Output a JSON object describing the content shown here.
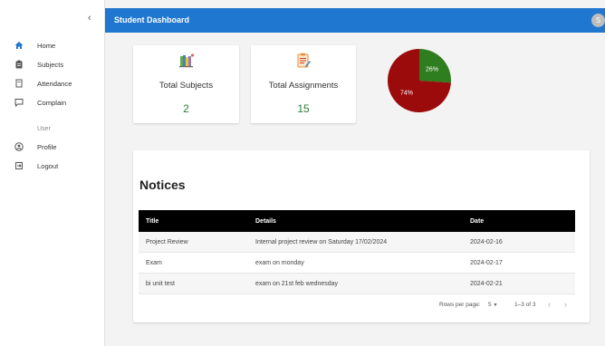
{
  "sidebar": {
    "collapse_label": "‹",
    "items": [
      {
        "label": "Home",
        "icon": "home-icon"
      },
      {
        "label": "Subjects",
        "icon": "clipboard-icon"
      },
      {
        "label": "Attendance",
        "icon": "document-icon"
      },
      {
        "label": "Complain",
        "icon": "comment-icon"
      }
    ],
    "section_label": "User",
    "user_items": [
      {
        "label": "Profile",
        "icon": "account-circle-icon"
      },
      {
        "label": "Logout",
        "icon": "logout-icon"
      }
    ]
  },
  "header": {
    "title": "Student Dashboard",
    "avatar_initial": "S"
  },
  "stats": [
    {
      "title": "Total Subjects",
      "value": "2",
      "icon": "books-icon"
    },
    {
      "title": "Total Assignments",
      "value": "15",
      "icon": "assignment-icon"
    }
  ],
  "chart_data": {
    "type": "pie",
    "slices": [
      {
        "label": "26%",
        "value": 26,
        "color": "#2e7d1e"
      },
      {
        "label": "74%",
        "value": 74,
        "color": "#9b0b0b"
      }
    ]
  },
  "notices": {
    "title": "Notices",
    "columns": [
      "Title",
      "Details",
      "Date"
    ],
    "rows": [
      [
        "Project Review",
        "Internal project review on Saturday 17/02/2024",
        "2024-02-16"
      ],
      [
        "Exam",
        "exam on monday",
        "2024-02-17"
      ],
      [
        "bi unit test",
        "exam on 21st feb wednesday",
        "2024-02-21"
      ]
    ],
    "pagination": {
      "rows_per_page_label": "Rows per page:",
      "rows_per_page_value": "5",
      "range": "1–3 of 3",
      "prev": "‹",
      "next": "›"
    }
  },
  "colors": {
    "header": "#1f77d0",
    "accent_value": "#2e7d32",
    "table_header": "#000000"
  }
}
